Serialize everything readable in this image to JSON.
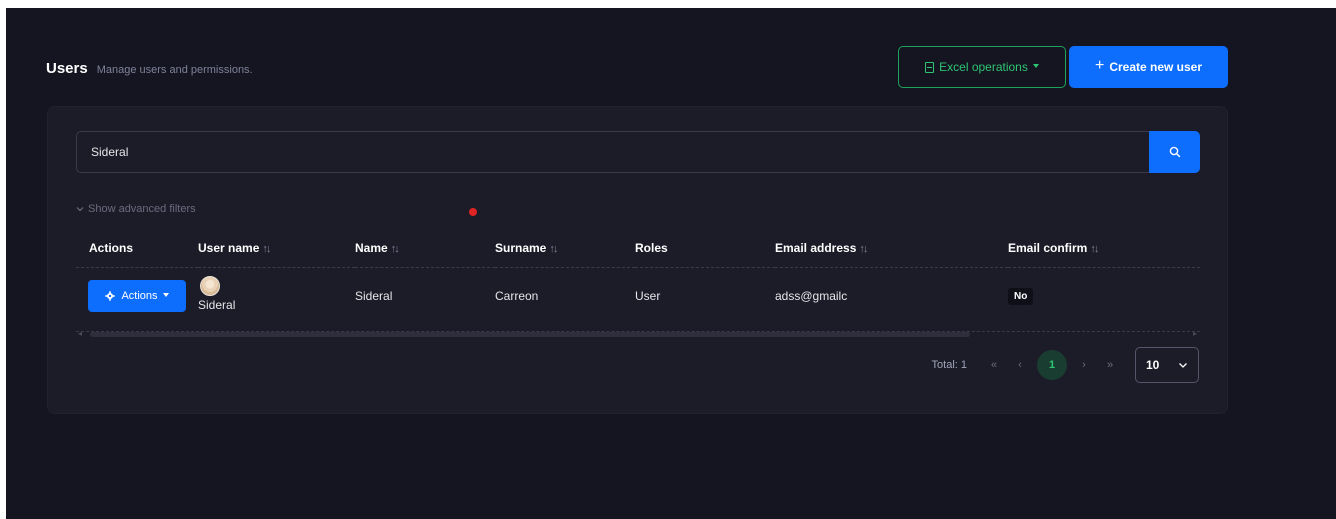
{
  "header": {
    "title": "Users",
    "subtitle": "Manage users and permissions."
  },
  "toolbar": {
    "excel_label": "Excel operations",
    "create_label": "Create new user",
    "create_prefix": "+"
  },
  "search": {
    "value": "Sideral",
    "placeholder": ""
  },
  "filters": {
    "advanced_label": "Show advanced filters"
  },
  "table": {
    "columns": {
      "actions": "Actions",
      "username": "User name",
      "name": "Name",
      "surname": "Surname",
      "roles": "Roles",
      "email": "Email address",
      "email_confirm": "Email confirm"
    },
    "rows": [
      {
        "actions_label": "Actions",
        "username": "Sideral",
        "name": "Sideral",
        "surname": "Carreon",
        "roles": "User",
        "email": "adss@gmailc",
        "email_confirm": "No"
      }
    ]
  },
  "pagination": {
    "total": "Total: 1",
    "first": "«",
    "prev": "‹",
    "current": "1",
    "next": "›",
    "last": "»",
    "page_size": "10"
  },
  "colors": {
    "background": "#151521",
    "card": "#1c1c28",
    "primary": "#0d6efd",
    "success": "#2ec572",
    "danger": "#e02424"
  },
  "icons": {
    "excel": "document-icon",
    "search": "search-icon",
    "filters": "chevron-down-icon",
    "actions": "gear-icon",
    "sort": "sort-icon",
    "page_size": "chevron-down-icon"
  }
}
